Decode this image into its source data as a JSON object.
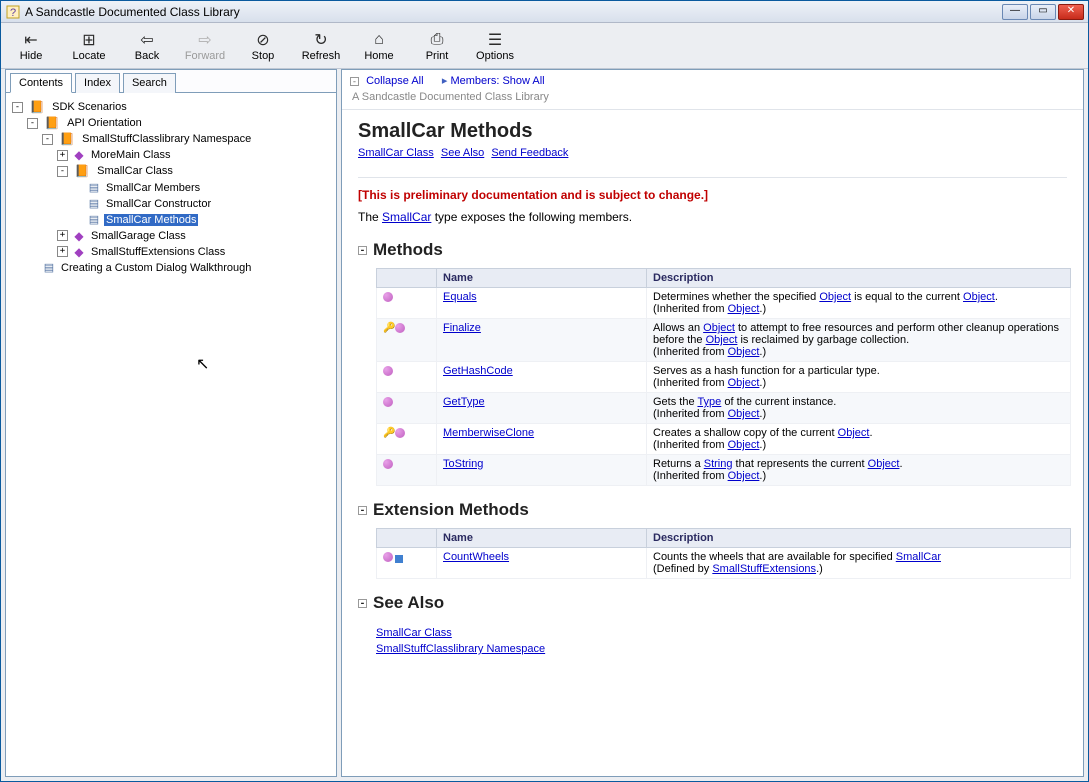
{
  "window": {
    "title": "A Sandcastle Documented Class Library"
  },
  "toolbar": {
    "hide": "Hide",
    "locate": "Locate",
    "back": "Back",
    "forward": "Forward",
    "stop": "Stop",
    "refresh": "Refresh",
    "home": "Home",
    "print": "Print",
    "options": "Options"
  },
  "tabs": {
    "contents": "Contents",
    "index": "Index",
    "search": "Search"
  },
  "tree": {
    "root": "SDK Scenarios",
    "api_orientation": "API Orientation",
    "namespace": "SmallStuffClasslibrary Namespace",
    "moremain": "MoreMain Class",
    "smallcar": "SmallCar Class",
    "members": "SmallCar Members",
    "constructor": "SmallCar Constructor",
    "methods": "SmallCar Methods",
    "smallgarage": "SmallGarage Class",
    "extensions": "SmallStuffExtensions Class",
    "walkthrough": "Creating a Custom Dialog Walkthrough"
  },
  "topbar": {
    "collapse": "Collapse All",
    "members": "Members: Show All"
  },
  "crumb": "A Sandcastle Documented Class Library",
  "page": {
    "title": "SmallCar Methods",
    "link_class": "SmallCar Class",
    "link_seealso": "See Also",
    "link_feedback": "Send Feedback",
    "warn": "[This is preliminary documentation and is subject to change.]",
    "expose_pre": "The ",
    "expose_link": "SmallCar",
    "expose_post": " type exposes the following members."
  },
  "sections": {
    "methods": "Methods",
    "ext": "Extension Methods",
    "seealso": "See Also"
  },
  "table_headers": {
    "icon": "",
    "name": "Name",
    "desc": "Description"
  },
  "methods": [
    {
      "name": "Equals",
      "desc_pre": "Determines whether the specified ",
      "link1": "Object",
      "mid": " is equal to the current ",
      "link2": "Object",
      "post": ".",
      "inh_from": "Object",
      "protected": false
    },
    {
      "name": "Finalize",
      "desc_pre": "Allows an ",
      "link1": "Object",
      "mid": " to attempt to free resources and perform other cleanup operations before the ",
      "link2": "Object",
      "post": " is reclaimed by garbage collection.",
      "inh_from": "Object",
      "protected": true
    },
    {
      "name": "GetHashCode",
      "desc_plain": "Serves as a hash function for a particular type.",
      "inh_from": "Object",
      "protected": false
    },
    {
      "name": "GetType",
      "desc_pre": "Gets the ",
      "link1": "Type",
      "post": " of the current instance.",
      "inh_from": "Object",
      "protected": false
    },
    {
      "name": "MemberwiseClone",
      "desc_pre": "Creates a shallow copy of the current ",
      "link1": "Object",
      "post": ".",
      "inh_from": "Object",
      "protected": true
    },
    {
      "name": "ToString",
      "desc_pre": "Returns a ",
      "link1": "String",
      "mid": " that represents the current ",
      "link2": "Object",
      "post": ".",
      "inh_from": "Object",
      "protected": false
    }
  ],
  "inherited_label_pre": "(Inherited from ",
  "inherited_label_post": ".)",
  "ext_methods": [
    {
      "name": "CountWheels",
      "desc_pre": "Counts the wheels that are available for specified ",
      "link1": "SmallCar",
      "defined_by": "SmallStuffExtensions"
    }
  ],
  "defined_label_pre": "(Defined by ",
  "defined_label_post": ".)",
  "seealso_links": {
    "class": "SmallCar Class",
    "ns": "SmallStuffClasslibrary Namespace"
  }
}
